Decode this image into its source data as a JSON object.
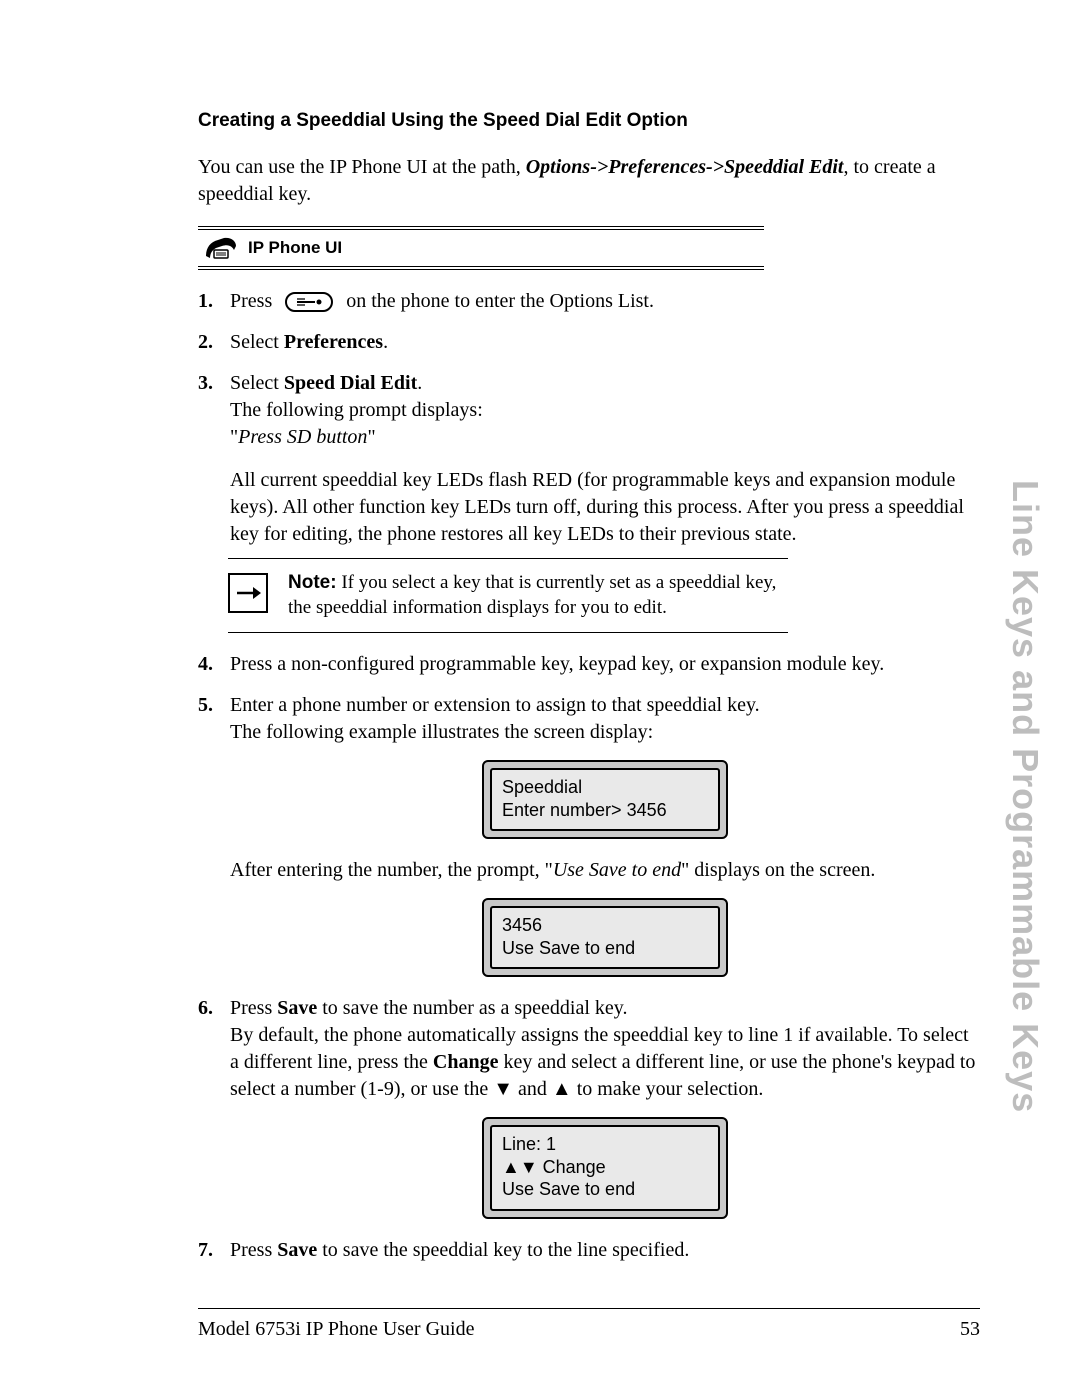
{
  "section_title": "Creating a Speeddial Using the Speed Dial Edit Option",
  "intro_prefix": "You can use the IP Phone UI at the path, ",
  "intro_path_italic": "Options->Preferences->Speeddial Edit",
  "intro_suffix": ", to create a speeddial key.",
  "ui_banner_label": "IP Phone UI",
  "step1_a": "Press ",
  "step1_b": " on the phone to enter the Options List.",
  "step2_a": "Select ",
  "step2_bold": "Preferences",
  "step2_c": ".",
  "step3_a": "Select ",
  "step3_bold": "Speed Dial Edit",
  "step3_c": ".",
  "step3_line2": "The following prompt displays:",
  "step3_quote": "\"",
  "step3_italic": "Press SD button",
  "step3_quote2": "\"",
  "step3_para": "All current speeddial key LEDs flash RED (for programmable keys and expansion module keys). All other function key LEDs turn off, during this process. After you press a speeddial key for editing, the phone restores all key LEDs to their previous state.",
  "note_bold": "Note:",
  "note_text": " If you select a key that is currently set as a speeddial key, the speeddial information displays for you to edit.",
  "step4": "Press a non-configured programmable key, keypad key, or expansion module key.",
  "step5_l1": "Enter a phone number or extension to assign to that speeddial key.",
  "step5_l2": "The following example illustrates the screen display:",
  "lcd1_l1": "Speeddial",
  "lcd1_l2": "Enter number>  3456",
  "after_lcd1_a": "After entering the number, the prompt, \"",
  "after_lcd1_ital": "Use Save to end",
  "after_lcd1_b": "\" displays on the screen.",
  "lcd2_l1": "3456",
  "lcd2_l2": "Use Save to end",
  "step6_a": "Press ",
  "step6_bold1": "Save",
  "step6_b": " to save the number as a speeddial key.",
  "step6_para_a": "By default, the phone automatically assigns the speeddial key to line 1 if available. To select a different line, press the ",
  "step6_bold2": "Change",
  "step6_para_b": " key and select a different line, or use the phone's keypad to select a number (1-9), or use the ",
  "step6_para_c": " and ",
  "step6_para_d": " to make your selection.",
  "lcd3_l1": "Line: 1",
  "lcd3_l2": "▲▼ Change",
  "lcd3_l3": "Use Save to end",
  "step7_a": "Press ",
  "step7_bold": "Save",
  "step7_b": " to save the speeddial key to the line specified.",
  "side_label": "Line Keys and Programmable Keys",
  "footer_left": "Model 6753i IP Phone User Guide",
  "footer_right": "53",
  "triangle_down": "▼",
  "triangle_up": "▲"
}
